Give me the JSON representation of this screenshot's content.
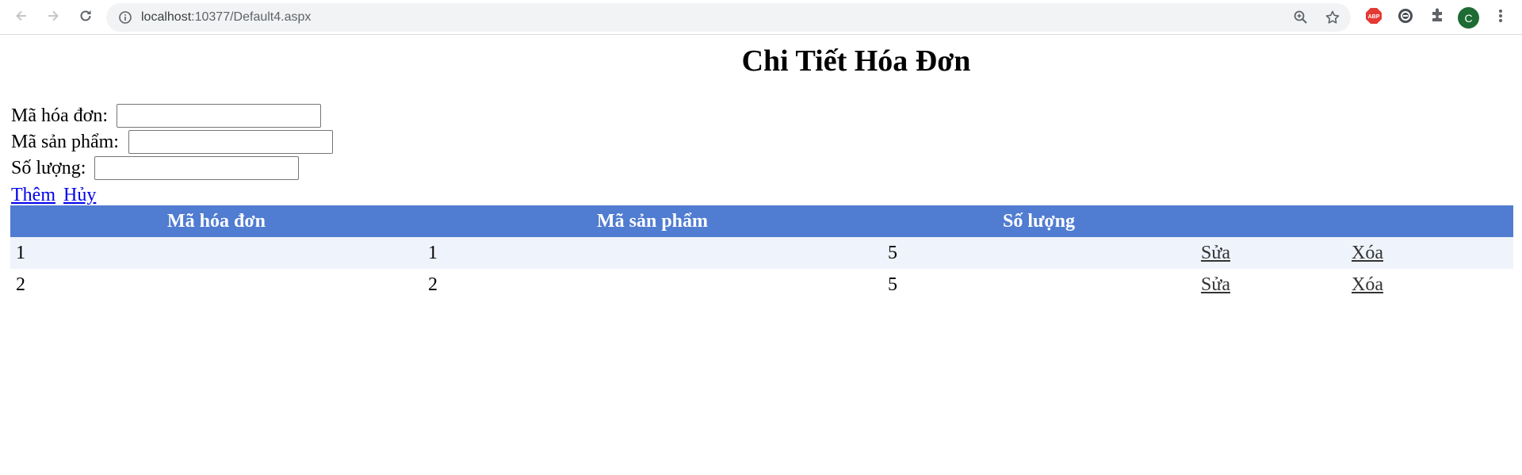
{
  "browser": {
    "url_host": "localhost",
    "url_rest": ":10377/Default4.aspx",
    "profile_initial": "C",
    "colors": {
      "avatar": "#1e6b34",
      "abp": "#e53935"
    }
  },
  "page": {
    "title": "Chi Tiết Hóa Đơn",
    "form": {
      "invoice_label": "Mã hóa đơn:",
      "invoice_value": "",
      "product_label": "Mã sản phẩm:",
      "product_value": "",
      "quantity_label": "Số lượng:",
      "quantity_value": ""
    },
    "actions": {
      "add": "Thêm",
      "cancel": "Hủy"
    },
    "grid": {
      "columns": [
        "Mã hóa đơn",
        "Mã sản phẩm",
        "Số lượng",
        "",
        ""
      ],
      "rows": [
        {
          "invoice": "1",
          "product": "1",
          "quantity": "5",
          "edit": "Sửa",
          "delete": "Xóa"
        },
        {
          "invoice": "2",
          "product": "2",
          "quantity": "5",
          "edit": "Sửa",
          "delete": "Xóa"
        }
      ],
      "colors": {
        "header": "#507cd1",
        "alt_row": "#eff3fb"
      }
    }
  }
}
